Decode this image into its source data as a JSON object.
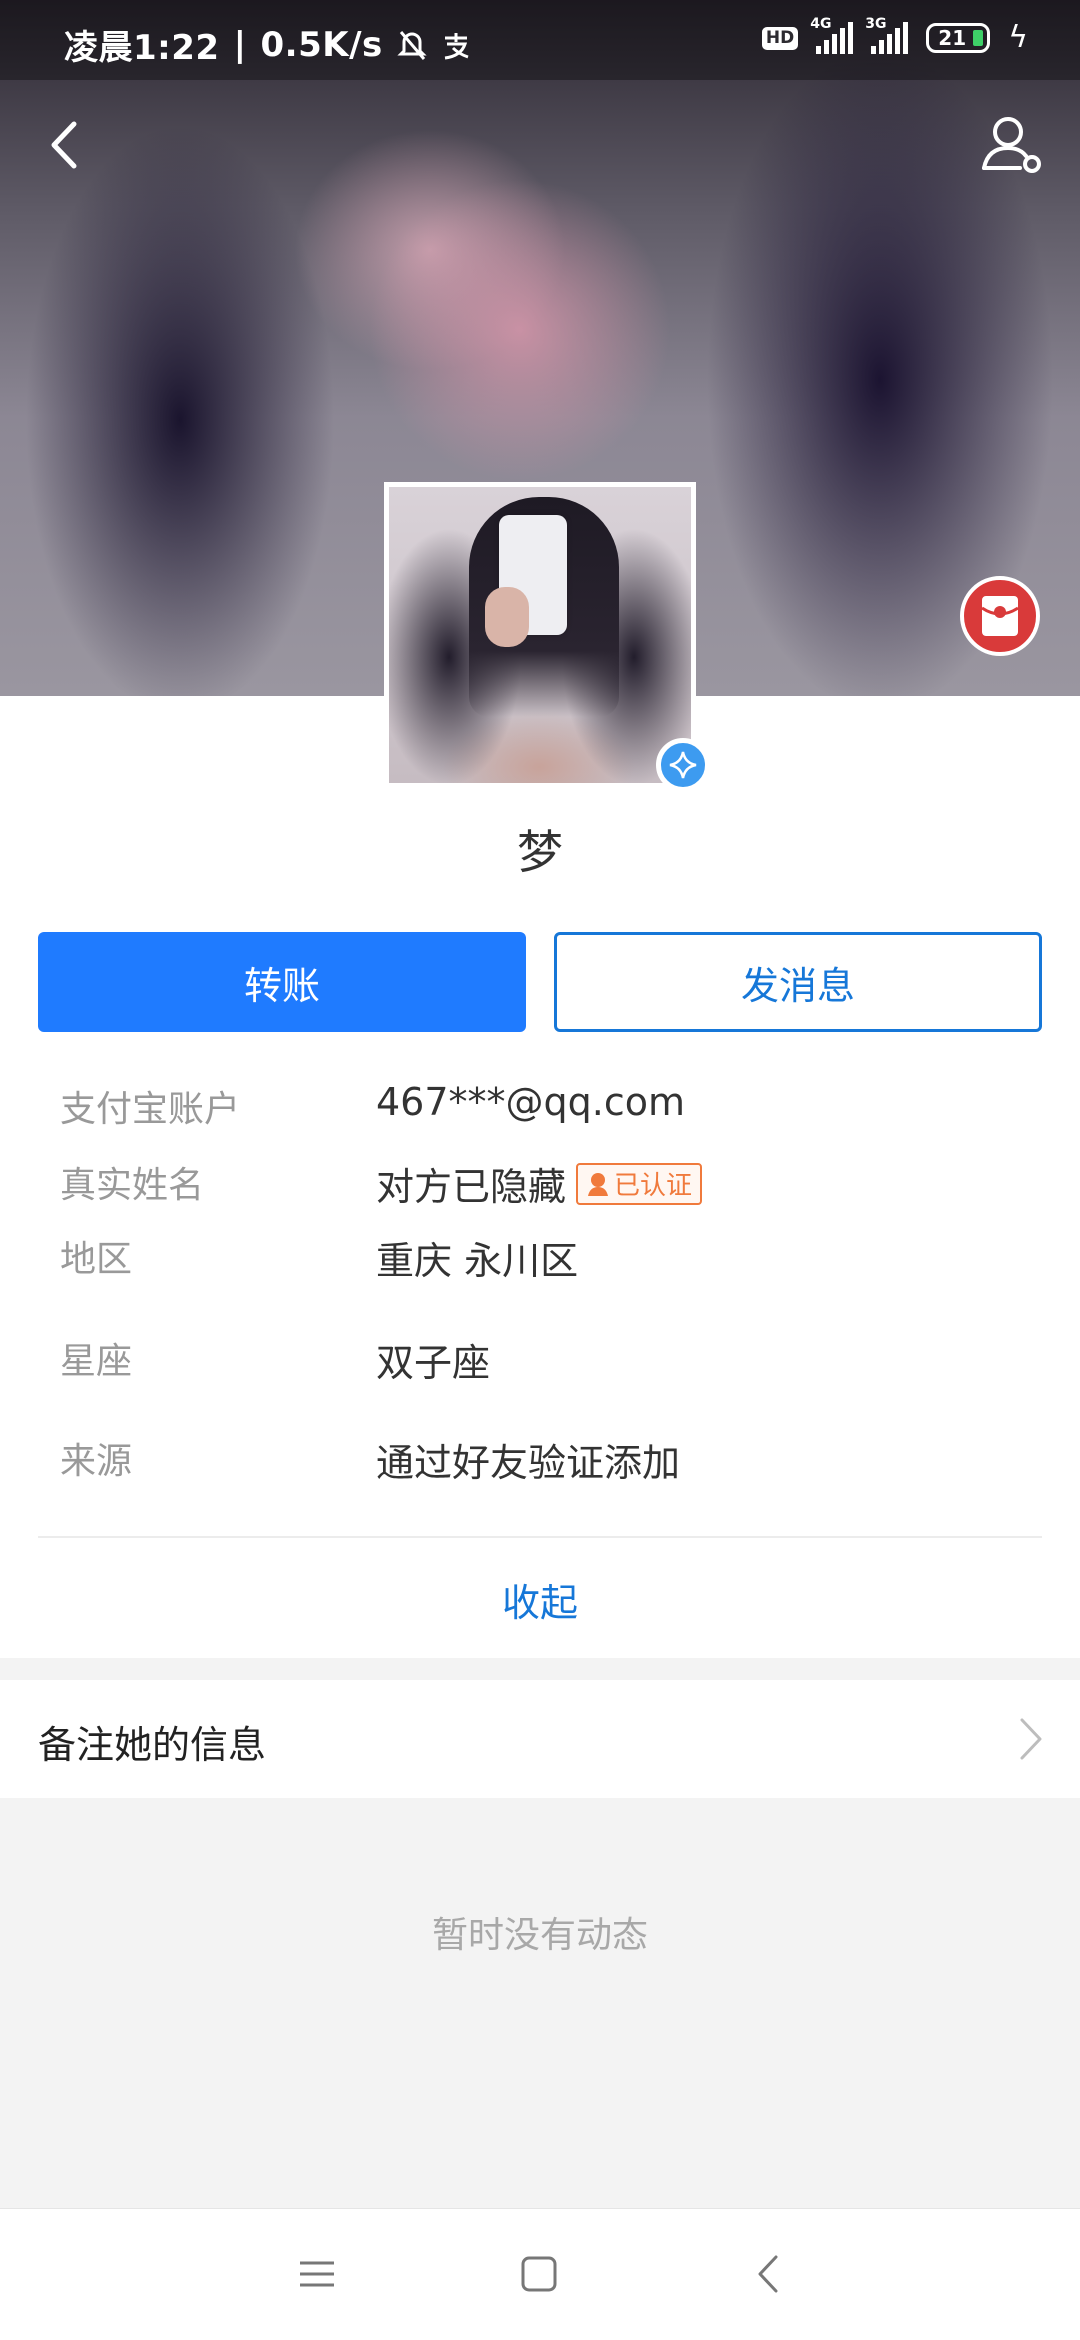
{
  "status_bar": {
    "time": "凌晨1:22",
    "speed": "0.5K/s",
    "hd_label": "HD",
    "network_1": "4G",
    "network_2": "3G",
    "battery": "21"
  },
  "header": {
    "back_icon": "back-chevron-icon",
    "user_icon": "user-settings-icon",
    "red_packet_icon": "red-packet-icon"
  },
  "profile": {
    "nickname": "梦",
    "verified_icon": "verified-star-icon"
  },
  "actions": {
    "transfer_label": "转账",
    "message_label": "发消息"
  },
  "info": [
    {
      "label": "支付宝账户",
      "value": "467***@qq.com"
    },
    {
      "label": "真实姓名",
      "value": "对方已隐藏",
      "badge": "已认证"
    },
    {
      "label": "地区",
      "value": "重庆 永川区"
    },
    {
      "label": "星座",
      "value": "双子座"
    },
    {
      "label": "来源",
      "value": "通过好友验证添加"
    }
  ],
  "collapse_label": "收起",
  "remark_label": "备注她的信息",
  "empty_text": "暂时没有动态",
  "colors": {
    "primary": "#1f7bff",
    "link": "#1677d8",
    "badge": "#f07a3c",
    "red_packet": "#d93a3a"
  }
}
